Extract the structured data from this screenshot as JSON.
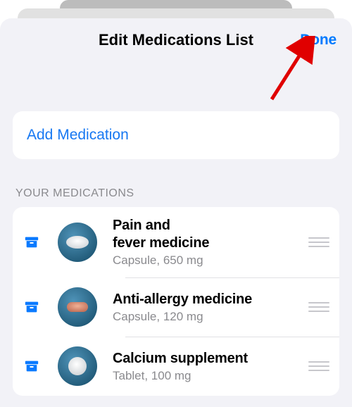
{
  "header": {
    "title": "Edit Medications List",
    "done_label": "Done"
  },
  "add_medication": {
    "label": "Add Medication"
  },
  "section_header": "YOUR MEDICATIONS",
  "medications": [
    {
      "name": "Pain and fever medicine",
      "details": "Capsule, 650 mg",
      "pill_bg": "#2a6f97",
      "pill_type": "capsule_white"
    },
    {
      "name": "Anti-allergy medicine",
      "details": "Capsule, 120 mg",
      "pill_bg": "#2a6f97",
      "pill_type": "capsule_pink"
    },
    {
      "name": "Calcium supplement",
      "details": "Tablet, 100 mg",
      "pill_bg": "#2a6f97",
      "pill_type": "tablet_white"
    }
  ],
  "colors": {
    "accent": "#007aff"
  }
}
